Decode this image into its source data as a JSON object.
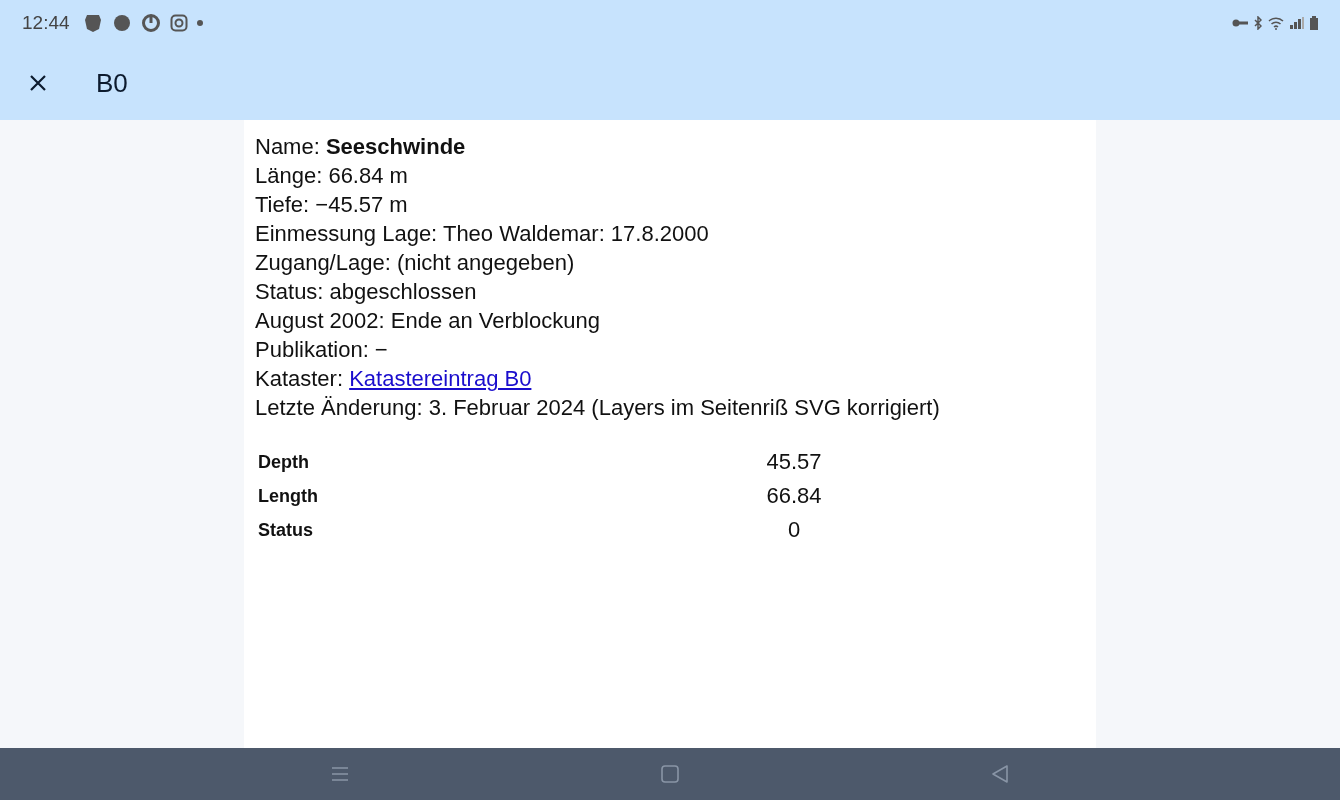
{
  "status_bar": {
    "time": "12:44"
  },
  "app_bar": {
    "title": "B0"
  },
  "lines": [
    {
      "kind": "text",
      "text": "Name: **Seeschwinde**"
    },
    {
      "kind": "text",
      "text": "Länge: 66.84 m"
    },
    {
      "kind": "text",
      "text": "Tiefe: −45.57 m"
    },
    {
      "kind": "text",
      "text": "Einmessung Lage: Theo Waldemar: 17.8.2000"
    },
    {
      "kind": "text",
      "text": "Zugang/Lage: (nicht angegeben)"
    },
    {
      "kind": "text",
      "text": "Status: abgeschlossen"
    },
    {
      "kind": "text",
      "text": "August 2002: Ende an Verblockung"
    },
    {
      "kind": "text",
      "text": "Publikation: −"
    },
    {
      "kind": "link",
      "label": "Kataster:",
      "link": "Katastereintrag B0"
    },
    {
      "kind": "text",
      "text": "Letzte Änderung: 3. Februar 2024 (Layers im Seitenriß SVG korrigiert)"
    }
  ],
  "table": {
    "rows": [
      {
        "label": "Depth",
        "value": "45.57"
      },
      {
        "label": "Length",
        "value": "66.84"
      },
      {
        "label": "Status",
        "value": "0"
      }
    ]
  }
}
